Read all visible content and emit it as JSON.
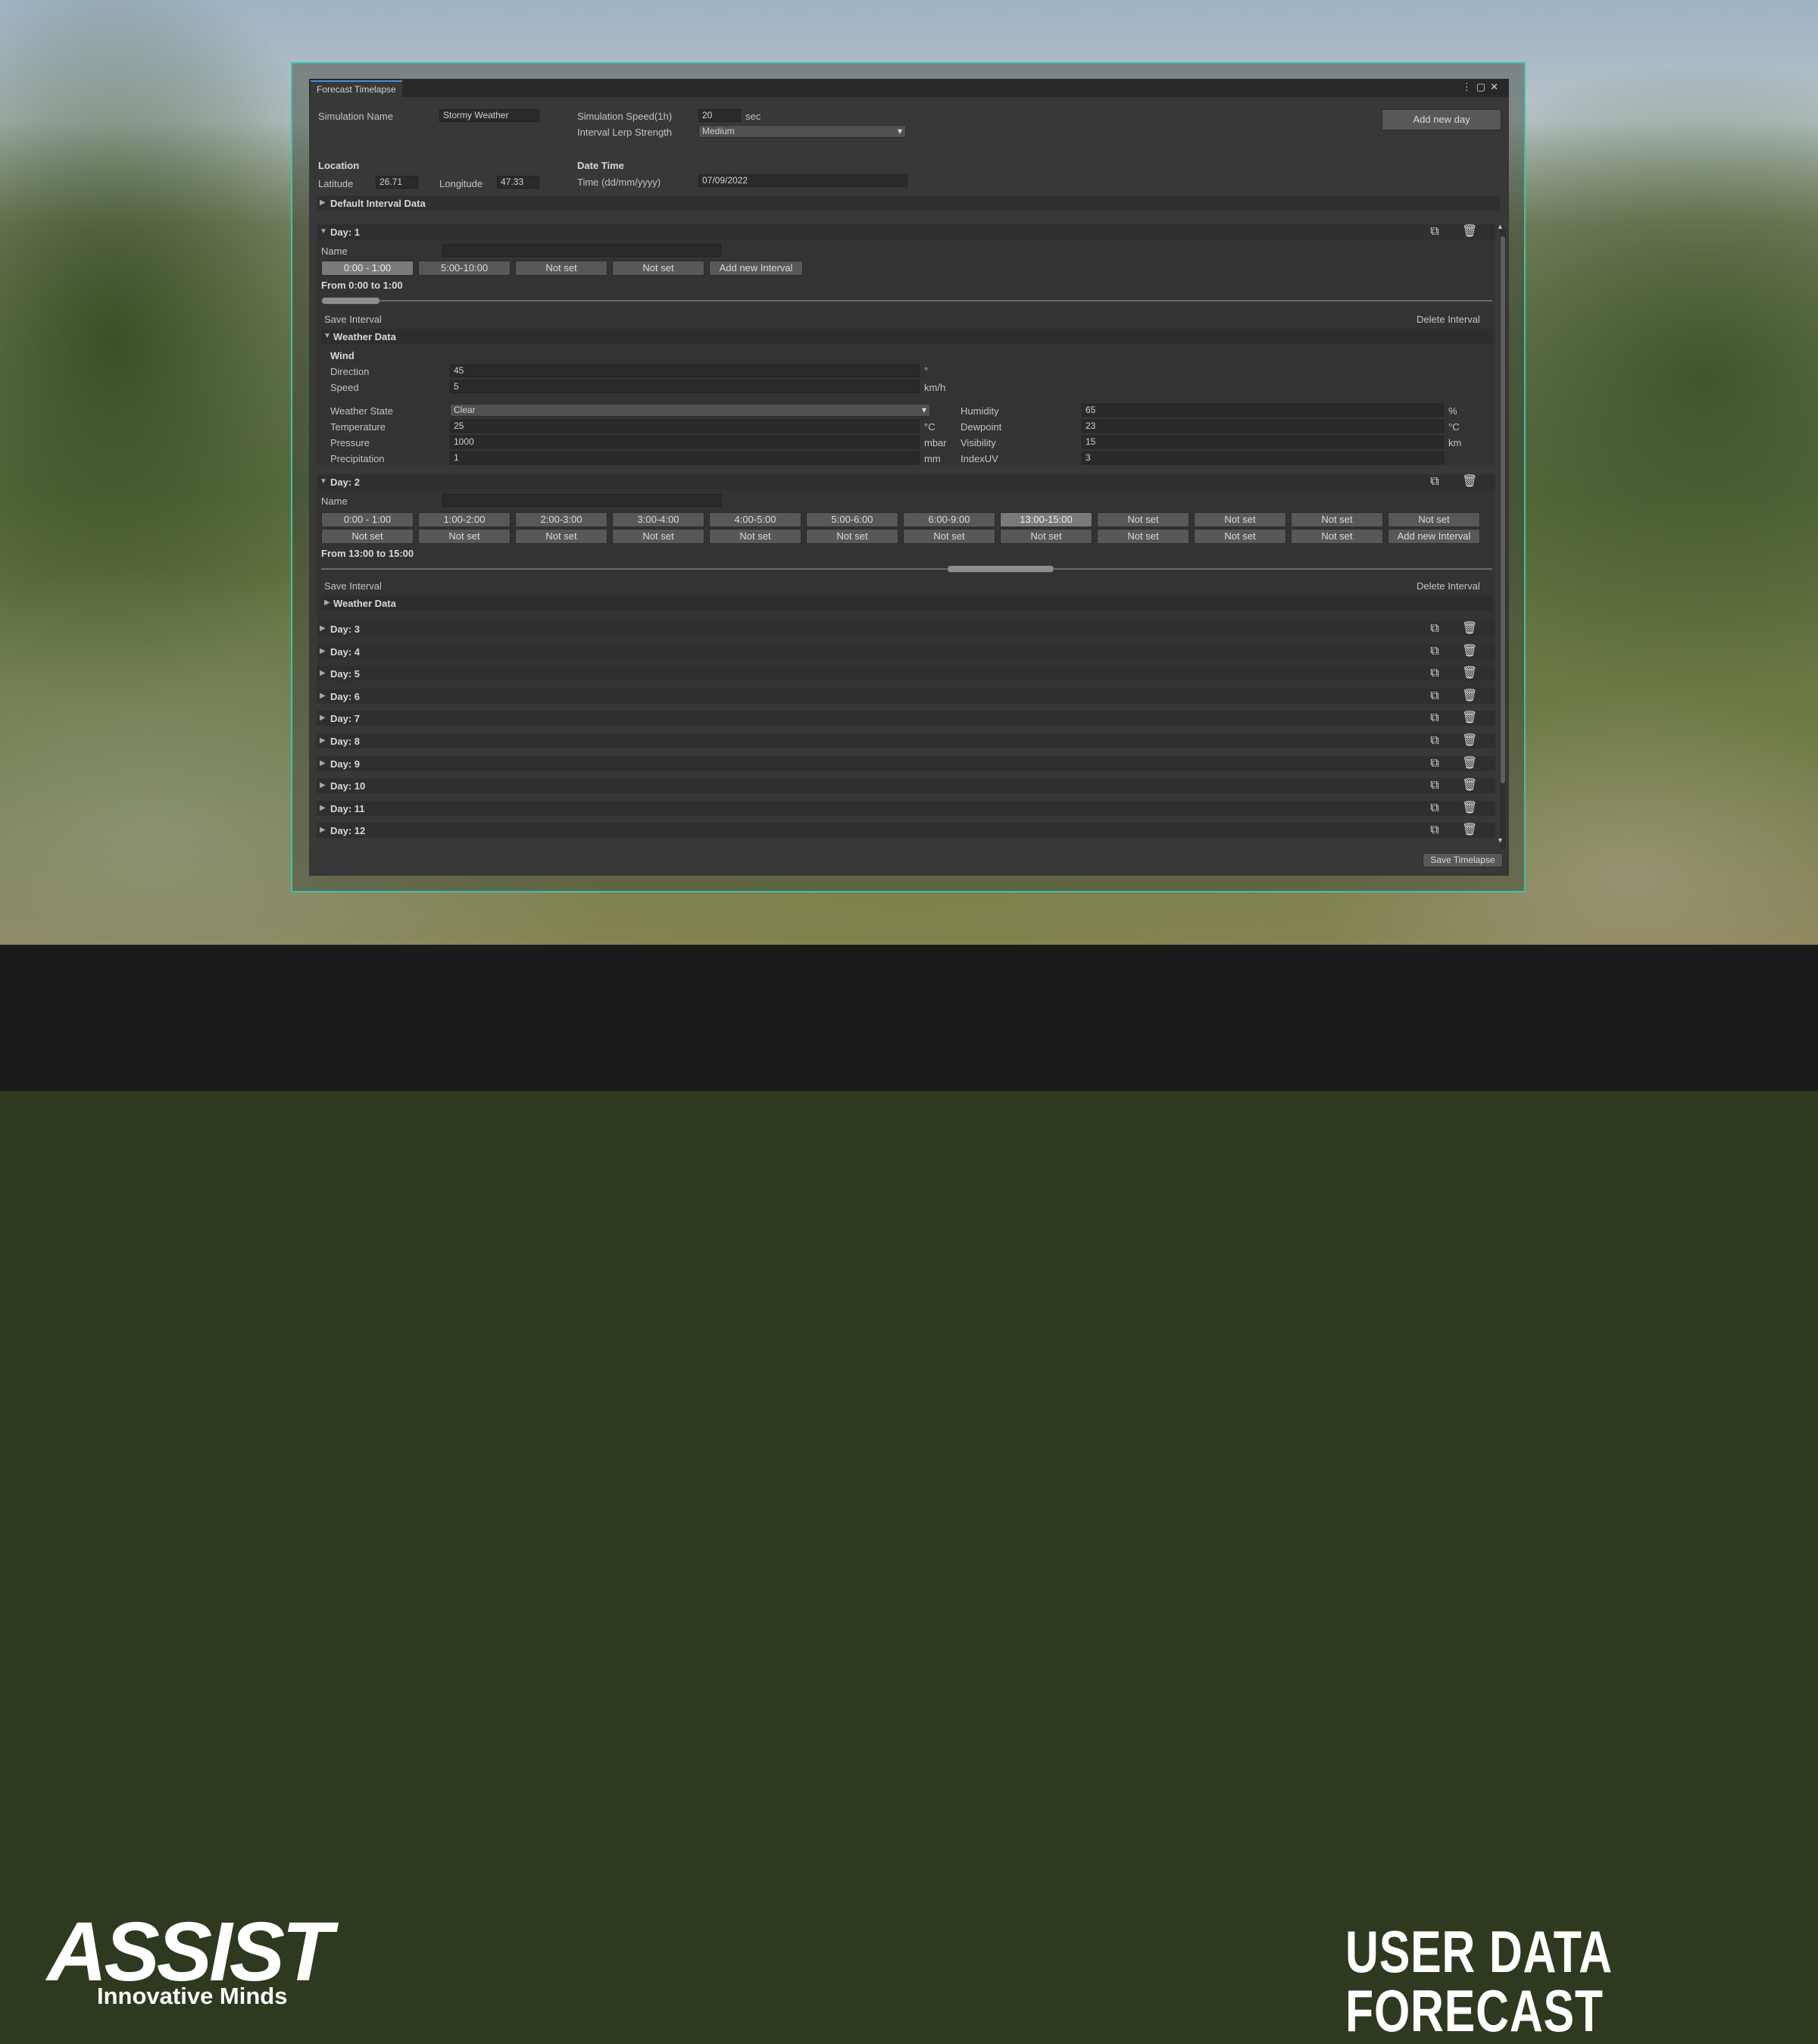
{
  "footer": {
    "logo": "ASSIST",
    "tagline": "Innovative Minds",
    "title": "USER DATA FORECAST"
  },
  "window": {
    "tab_title": "Forecast Timelapse",
    "icons": [
      "more-icon",
      "maximize-icon",
      "close-icon"
    ]
  },
  "header": {
    "sim_name_label": "Simulation Name",
    "sim_name_value": "Stormy Weather",
    "sim_speed_label": "Simulation Speed(1h)",
    "sim_speed_value": "20",
    "sim_speed_unit": "sec",
    "lerp_label": "Interval Lerp Strength",
    "lerp_value": "Medium",
    "add_day_label": "Add new day",
    "location_label": "Location",
    "latitude_label": "Latitude",
    "latitude_value": "26.71",
    "longitude_label": "Longitude",
    "longitude_value": "47.33",
    "datetime_label": "Date Time",
    "time_label": "Time (dd/mm/yyyy)",
    "time_value": "07/09/2022",
    "default_interval_label": "Default Interval Data"
  },
  "day1": {
    "title": "Day: 1",
    "name_label": "Name",
    "name_value": "",
    "intervals": [
      "0:00 - 1:00",
      "5:00-10:00",
      "Not set",
      "Not set"
    ],
    "add_interval_label": "Add new Interval",
    "range_text": "From 0:00 to 1:00",
    "range_fraction": 0.04,
    "save_interval_label": "Save Interval",
    "delete_interval_label": "Delete Interval",
    "weather_data_label": "Weather Data",
    "wind_label": "Wind",
    "direction_label": "Direction",
    "direction_value": "45",
    "direction_unit": "°",
    "speed_label": "Speed",
    "speed_value": "5",
    "speed_unit": "km/h",
    "weather_state_label": "Weather State",
    "weather_state_value": "Clear",
    "temperature_label": "Temperature",
    "temperature_value": "25",
    "temperature_unit": "°C",
    "pressure_label": "Pressure",
    "pressure_value": "1000",
    "pressure_unit": "mbar",
    "precipitation_label": "Precipitation",
    "precipitation_value": "1",
    "precipitation_unit": "mm",
    "humidity_label": "Humidity",
    "humidity_value": "65",
    "humidity_unit": "%",
    "dewpoint_label": "Dewpoint",
    "dewpoint_value": "23",
    "dewpoint_unit": "°C",
    "visibility_label": "Visibility",
    "visibility_value": "15",
    "visibility_unit": "km",
    "indexuv_label": "IndexUV",
    "indexuv_value": "3"
  },
  "day2": {
    "title": "Day: 2",
    "name_label": "Name",
    "row1": [
      "0:00 - 1:00",
      "1:00-2:00",
      "2:00-3:00",
      "3:00-4:00",
      "4:00-5:00",
      "5:00-6:00",
      "6:00-9:00",
      "13:00-15:00",
      "Not set",
      "Not set",
      "Not set",
      "Not set"
    ],
    "row2": [
      "Not set",
      "Not set",
      "Not set",
      "Not set",
      "Not set",
      "Not set",
      "Not set",
      "Not set",
      "Not set",
      "Not set",
      "Not set"
    ],
    "add_interval_label": "Add new Interval",
    "range_text": "From 13:00 to 15:00",
    "save_interval_label": "Save Interval",
    "delete_interval_label": "Delete Interval",
    "weather_data_label": "Weather Data"
  },
  "collapsed_days": [
    "Day: 3",
    "Day: 4",
    "Day: 5",
    "Day: 6",
    "Day: 7",
    "Day: 8",
    "Day: 9",
    "Day: 10",
    "Day: 11",
    "Day: 12"
  ],
  "save_timelapse_label": "Save Timelapse"
}
